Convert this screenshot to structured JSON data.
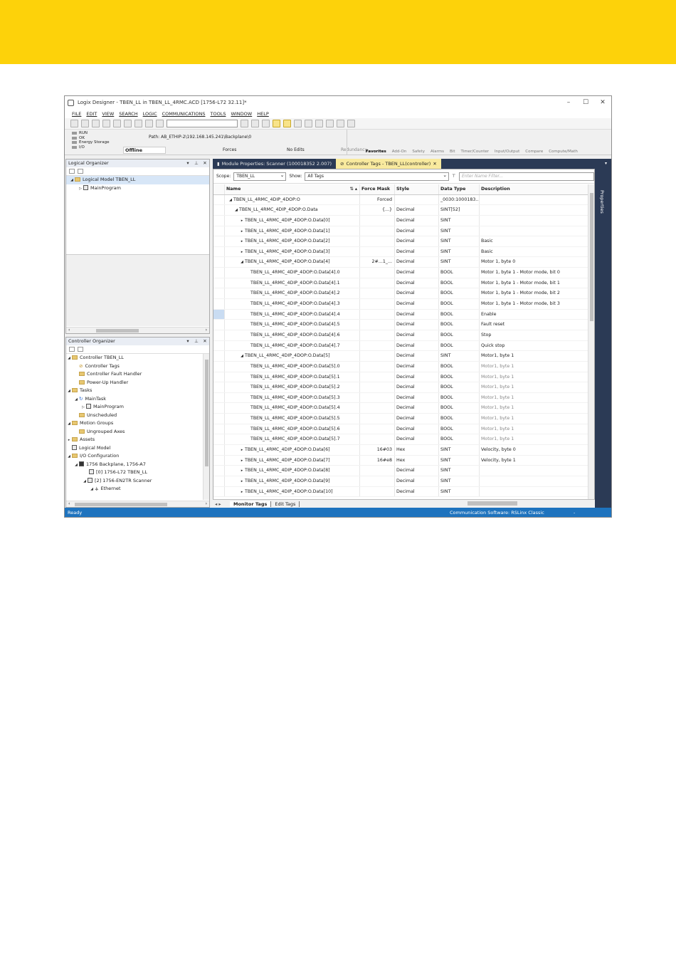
{
  "window": {
    "title": "Logix Designer - TBEN_LL in TBEN_LL_4RMC.ACD [1756-L72 32.11]*",
    "controls": [
      "–",
      "☐",
      "✕"
    ]
  },
  "menu": [
    "FILE",
    "EDIT",
    "VIEW",
    "SEARCH",
    "LOGIC",
    "COMMUNICATIONS",
    "TOOLS",
    "WINDOW",
    "HELP"
  ],
  "status": {
    "indicators": [
      "RUN",
      "OK",
      "Energy Storage",
      "I/O"
    ],
    "path_label": "Path: AB_ETHIP-2\\192.168.145.241\\Backplane\\0",
    "mode": "Offline",
    "forces": "Forces",
    "edits": "No Edits",
    "redundancy": "Redundancy"
  },
  "instruction_tabs": [
    "Favorites",
    "Add-On",
    "Safety",
    "Alarms",
    "Bit",
    "Timer/Counter",
    "Input/Output",
    "Compare",
    "Compute/Math"
  ],
  "logical_organizer": {
    "title": "Logical Organizer",
    "items": [
      "Logical Model TBEN_LL",
      "MainProgram"
    ]
  },
  "controller_organizer": {
    "title": "Controller Organizer",
    "items": [
      "Controller TBEN_LL",
      "Controller Tags",
      "Controller Fault Handler",
      "Power-Up Handler",
      "Tasks",
      "MainTask",
      "MainProgram",
      "Unscheduled",
      "Motion Groups",
      "Ungrouped Axes",
      "Assets",
      "Logical Model",
      "I/O Configuration",
      "1756 Backplane, 1756-A7",
      "[0] 1756-L72 TBEN_LL",
      "[2] 1756-EN2TR Scanner",
      "Ethernet"
    ]
  },
  "editor_tabs": [
    "Module Properties: Scanner (100018352 2.007)",
    "Controller Tags - TBEN_LL(controller)"
  ],
  "scope": {
    "label": "Scope:",
    "value": "TBEN_LL",
    "show_label": "Show:",
    "show_value": "All Tags",
    "filter_placeholder": "Enter Name Filter..."
  },
  "columns": [
    "Name",
    "Force Mask",
    "Style",
    "Data Type",
    "Description"
  ],
  "rows": [
    {
      "name": "TBEN_LL_4RMC_4DIP_4DOP:O",
      "force": "Forced",
      "style": "",
      "type": "_0030:1000183...",
      "desc": ""
    },
    {
      "name": "TBEN_LL_4RMC_4DIP_4DOP:O.Data",
      "force": "{...}",
      "style": "Decimal",
      "type": "SINT[52]",
      "desc": ""
    },
    {
      "name": "TBEN_LL_4RMC_4DIP_4DOP:O.Data[0]",
      "force": "",
      "style": "Decimal",
      "type": "SINT",
      "desc": ""
    },
    {
      "name": "TBEN_LL_4RMC_4DIP_4DOP:O.Data[1]",
      "force": "",
      "style": "Decimal",
      "type": "SINT",
      "desc": ""
    },
    {
      "name": "TBEN_LL_4RMC_4DIP_4DOP:O.Data[2]",
      "force": "",
      "style": "Decimal",
      "type": "SINT",
      "desc": "Basic"
    },
    {
      "name": "TBEN_LL_4RMC_4DIP_4DOP:O.Data[3]",
      "force": "",
      "style": "Decimal",
      "type": "SINT",
      "desc": "Basic"
    },
    {
      "name": "TBEN_LL_4RMC_4DIP_4DOP:O.Data[4]",
      "force": "2#...1_...",
      "style": "Decimal",
      "type": "SINT",
      "desc": "Motor 1, byte 0"
    },
    {
      "name": "TBEN_LL_4RMC_4DIP_4DOP:O.Data[4].0",
      "force": "",
      "style": "Decimal",
      "type": "BOOL",
      "desc": "Motor 1, byte 1 - Motor mode, bit 0"
    },
    {
      "name": "TBEN_LL_4RMC_4DIP_4DOP:O.Data[4].1",
      "force": "",
      "style": "Decimal",
      "type": "BOOL",
      "desc": "Motor 1, byte 1 - Motor mode, bit 1"
    },
    {
      "name": "TBEN_LL_4RMC_4DIP_4DOP:O.Data[4].2",
      "force": "",
      "style": "Decimal",
      "type": "BOOL",
      "desc": "Motor 1, byte 1 - Motor mode, bit 2"
    },
    {
      "name": "TBEN_LL_4RMC_4DIP_4DOP:O.Data[4].3",
      "force": "",
      "style": "Decimal",
      "type": "BOOL",
      "desc": "Motor 1, byte 1 - Motor mode, bit 3"
    },
    {
      "name": "TBEN_LL_4RMC_4DIP_4DOP:O.Data[4].4",
      "force": "",
      "style": "Decimal",
      "type": "BOOL",
      "desc": "Enable"
    },
    {
      "name": "TBEN_LL_4RMC_4DIP_4DOP:O.Data[4].5",
      "force": "",
      "style": "Decimal",
      "type": "BOOL",
      "desc": "Fault reset"
    },
    {
      "name": "TBEN_LL_4RMC_4DIP_4DOP:O.Data[4].6",
      "force": "",
      "style": "Decimal",
      "type": "BOOL",
      "desc": "Stop"
    },
    {
      "name": "TBEN_LL_4RMC_4DIP_4DOP:O.Data[4].7",
      "force": "",
      "style": "Decimal",
      "type": "BOOL",
      "desc": "Quick stop"
    },
    {
      "name": "TBEN_LL_4RMC_4DIP_4DOP:O.Data[5]",
      "force": "",
      "style": "Decimal",
      "type": "SINT",
      "desc": "Motor1, byte 1"
    },
    {
      "name": "TBEN_LL_4RMC_4DIP_4DOP:O.Data[5].0",
      "force": "",
      "style": "Decimal",
      "type": "BOOL",
      "desc": "Motor1, byte 1"
    },
    {
      "name": "TBEN_LL_4RMC_4DIP_4DOP:O.Data[5].1",
      "force": "",
      "style": "Decimal",
      "type": "BOOL",
      "desc": "Motor1, byte 1"
    },
    {
      "name": "TBEN_LL_4RMC_4DIP_4DOP:O.Data[5].2",
      "force": "",
      "style": "Decimal",
      "type": "BOOL",
      "desc": "Motor1, byte 1"
    },
    {
      "name": "TBEN_LL_4RMC_4DIP_4DOP:O.Data[5].3",
      "force": "",
      "style": "Decimal",
      "type": "BOOL",
      "desc": "Motor1, byte 1"
    },
    {
      "name": "TBEN_LL_4RMC_4DIP_4DOP:O.Data[5].4",
      "force": "",
      "style": "Decimal",
      "type": "BOOL",
      "desc": "Motor1, byte 1"
    },
    {
      "name": "TBEN_LL_4RMC_4DIP_4DOP:O.Data[5].5",
      "force": "",
      "style": "Decimal",
      "type": "BOOL",
      "desc": "Motor1, byte 1"
    },
    {
      "name": "TBEN_LL_4RMC_4DIP_4DOP:O.Data[5].6",
      "force": "",
      "style": "Decimal",
      "type": "BOOL",
      "desc": "Motor1, byte 1"
    },
    {
      "name": "TBEN_LL_4RMC_4DIP_4DOP:O.Data[5].7",
      "force": "",
      "style": "Decimal",
      "type": "BOOL",
      "desc": "Motor1, byte 1"
    },
    {
      "name": "TBEN_LL_4RMC_4DIP_4DOP:O.Data[6]",
      "force": "16#03",
      "style": "Hex",
      "type": "SINT",
      "desc": "Velocity, byte 0"
    },
    {
      "name": "TBEN_LL_4RMC_4DIP_4DOP:O.Data[7]",
      "force": "16#e8",
      "style": "Hex",
      "type": "SINT",
      "desc": "Velocity, byte 1"
    },
    {
      "name": "TBEN_LL_4RMC_4DIP_4DOP:O.Data[8]",
      "force": "",
      "style": "Decimal",
      "type": "SINT",
      "desc": ""
    },
    {
      "name": "TBEN_LL_4RMC_4DIP_4DOP:O.Data[9]",
      "force": "",
      "style": "Decimal",
      "type": "SINT",
      "desc": ""
    },
    {
      "name": "TBEN_LL_4RMC_4DIP_4DOP:O.Data[10]",
      "force": "",
      "style": "Decimal",
      "type": "SINT",
      "desc": ""
    }
  ],
  "properties_label": "Properties",
  "bottom_tabs": [
    "Monitor Tags",
    "Edit Tags"
  ],
  "statusbar": {
    "text": "Ready",
    "comm": "Communication Software: RSLinx Classic",
    "extra": "-"
  },
  "colors": {
    "brand_band": "#fdd20a",
    "panel_dark": "#2b3a55",
    "status_blue": "#1e73be",
    "active_tab": "#f9ea9e"
  }
}
